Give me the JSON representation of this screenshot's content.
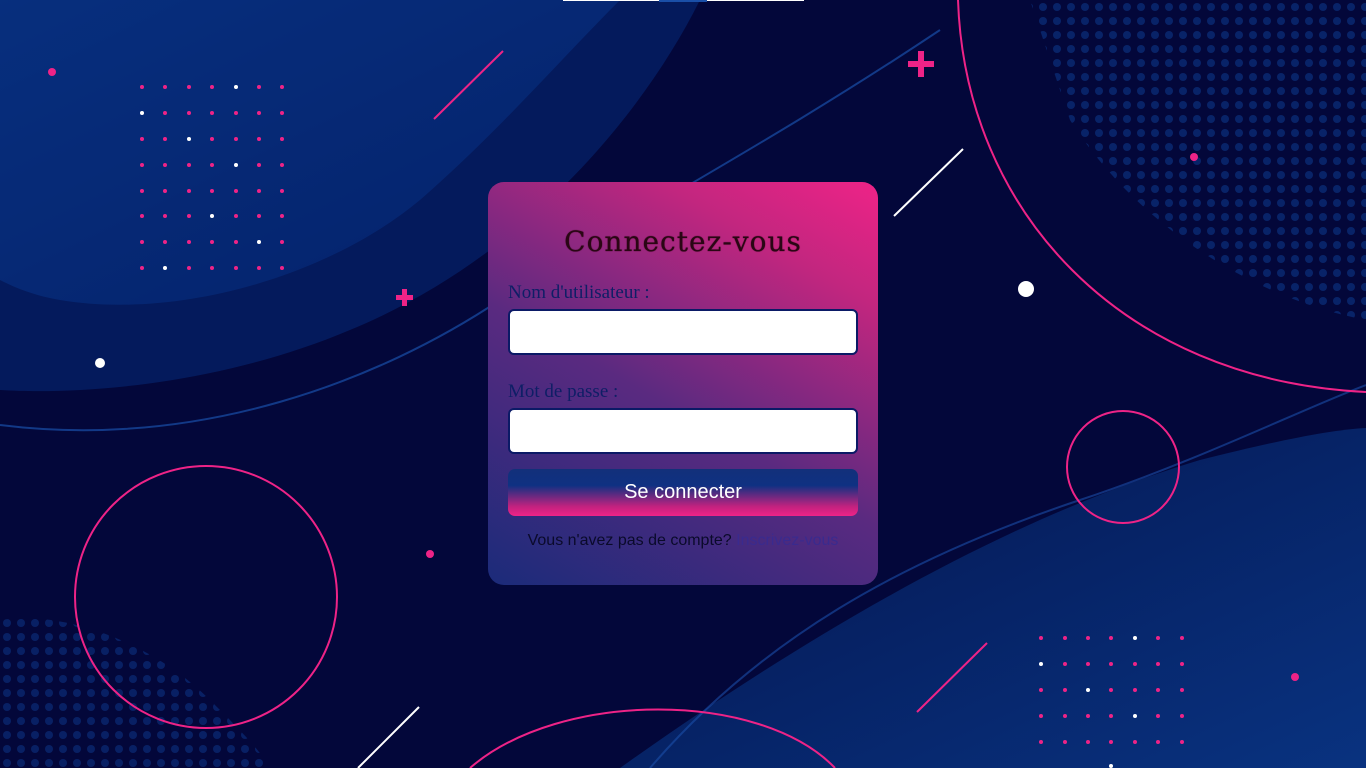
{
  "login": {
    "title": "Connectez-vous",
    "username_label": "Nom d'utilisateur :",
    "username_value": "",
    "password_label": "Mot de passe :",
    "password_value": "",
    "submit_label": "Se connecter",
    "signup_prompt": "Vous n'avez pas de compte?",
    "signup_link": "Inscrivez-vous"
  },
  "colors": {
    "background": "#03073a",
    "accent_pink": "#ee2387",
    "accent_blue": "#0f3182",
    "card_gradient_start": "#1b2b7a",
    "card_gradient_end": "#ee2387"
  },
  "decorations": {
    "shapes": [
      "plus-icon",
      "circle-outline",
      "dot-grid",
      "halftone-pattern",
      "diagonal-line",
      "wave"
    ]
  }
}
